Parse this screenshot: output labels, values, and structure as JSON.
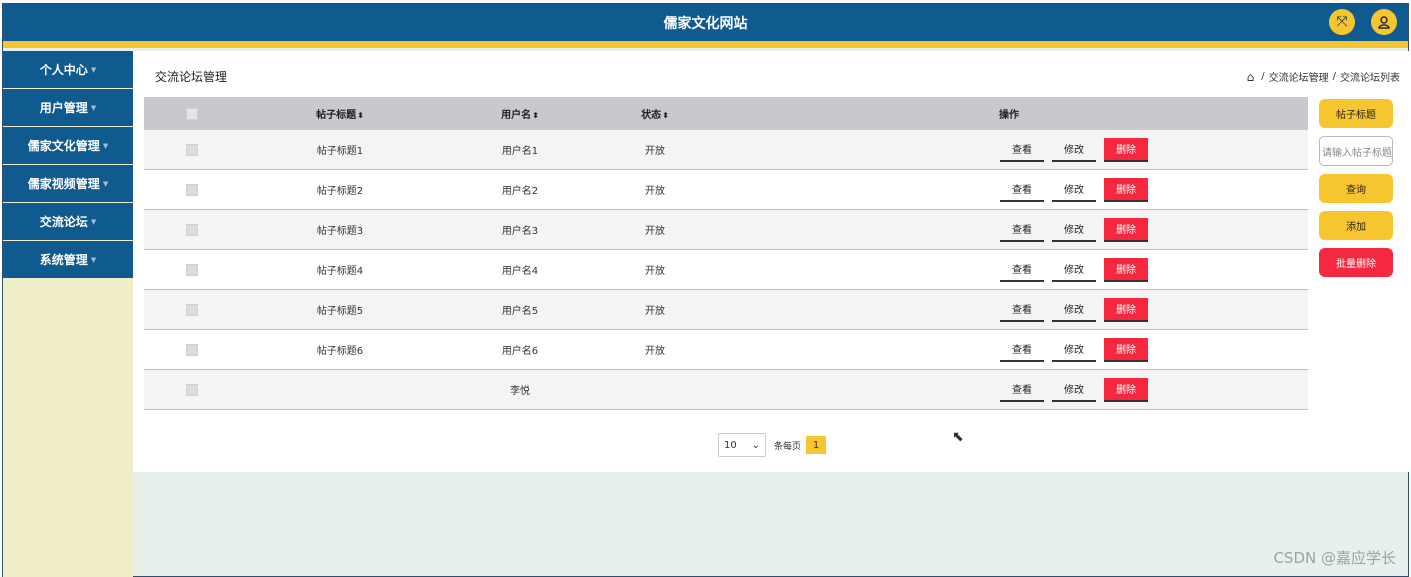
{
  "app": {
    "title": "儒家文化网站"
  },
  "header": {
    "icons": [
      "resize-icon",
      "user-icon"
    ]
  },
  "sidebar": {
    "items": [
      {
        "label": "个人中心"
      },
      {
        "label": "用户管理"
      },
      {
        "label": "儒家文化管理"
      },
      {
        "label": "儒家视频管理"
      },
      {
        "label": "交流论坛"
      },
      {
        "label": "系统管理"
      }
    ]
  },
  "page": {
    "title": "交流论坛管理",
    "breadcrumb": [
      "交流论坛管理",
      "交流论坛列表"
    ]
  },
  "table": {
    "headers": {
      "title": "帖子标题",
      "user": "用户名",
      "status": "状态",
      "ops": "操作"
    },
    "ops": {
      "view": "查看",
      "edit": "修改",
      "delete": "删除"
    },
    "rows": [
      {
        "title": "帖子标题1",
        "user": "用户名1",
        "status": "开放"
      },
      {
        "title": "帖子标题2",
        "user": "用户名2",
        "status": "开放"
      },
      {
        "title": "帖子标题3",
        "user": "用户名3",
        "status": "开放"
      },
      {
        "title": "帖子标题4",
        "user": "用户名4",
        "status": "开放"
      },
      {
        "title": "帖子标题5",
        "user": "用户名5",
        "status": "开放"
      },
      {
        "title": "帖子标题6",
        "user": "用户名6",
        "status": "开放"
      },
      {
        "title": "",
        "user": "李悦",
        "status": ""
      }
    ]
  },
  "pager": {
    "page_size": "10",
    "page_size_label": "条每页",
    "current_page": "1"
  },
  "search": {
    "field_label": "帖子标题",
    "placeholder": "请输入帖子标题",
    "query_label": "查询",
    "add_label": "添加",
    "batch_delete_label": "批量删除"
  },
  "watermark": "CSDN @嘉应学长",
  "colors": {
    "primary": "#0f5a8f",
    "accent": "#f7c62f",
    "danger": "#f5283f"
  }
}
